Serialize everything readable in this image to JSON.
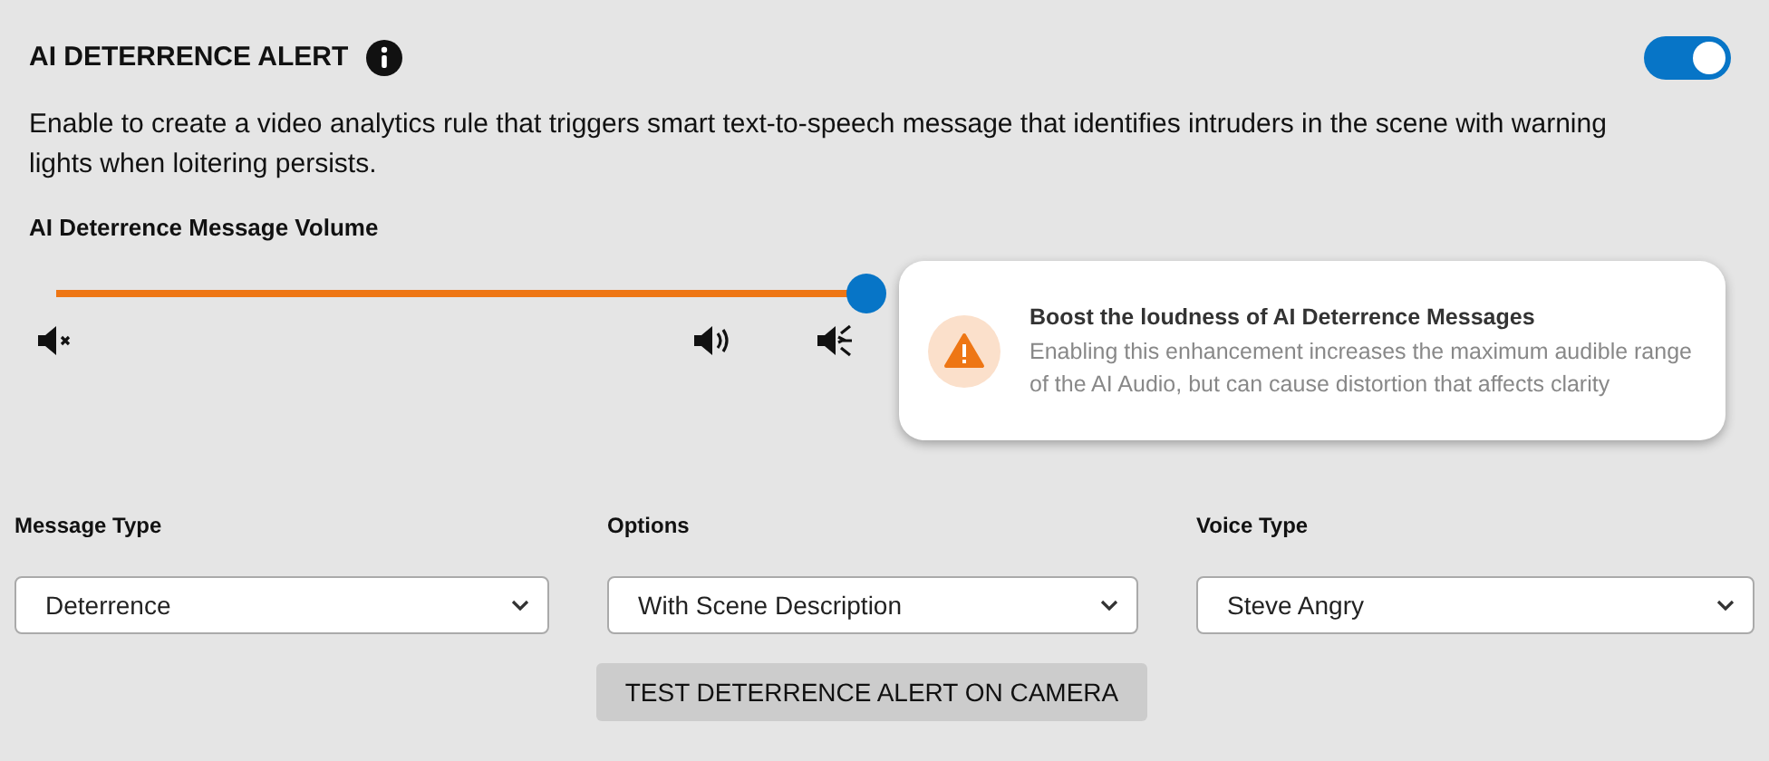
{
  "header": {
    "title": "AI DETERRENCE ALERT",
    "enabled": true
  },
  "description": "Enable to create a video analytics rule that triggers smart text-to-speech message that identifies intruders in the scene with warning lights when loitering persists.",
  "volume": {
    "label": "AI Deterrence Message Volume",
    "level": 1
  },
  "boost_notice": {
    "title": "Boost the loudness of AI Deterrence Messages",
    "body": "Enabling this enhancement increases the maximum audible range of the AI Audio, but can cause distortion that affects clarity"
  },
  "dropdowns": [
    {
      "label": "Message Type",
      "value": "Deterrence"
    },
    {
      "label": "Options",
      "value": "With Scene Description"
    },
    {
      "label": "Voice Type",
      "value": "Steve Angry"
    }
  ],
  "test_button": "TEST DETERRENCE ALERT ON CAMERA"
}
